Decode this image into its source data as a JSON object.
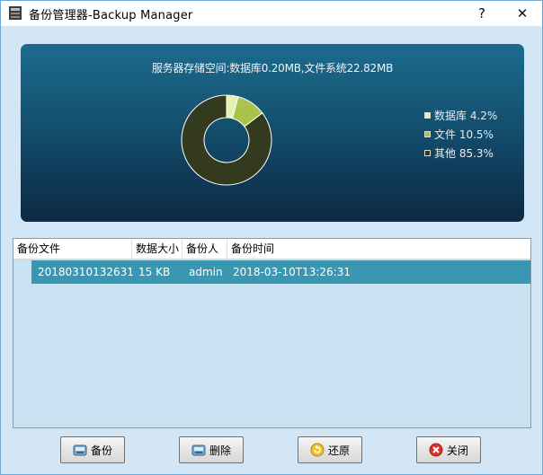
{
  "window": {
    "title": "备份管理器-Backup Manager",
    "help_label": "?",
    "close_label": "✕"
  },
  "chart_data": {
    "type": "pie",
    "title": "服务器存储空间:数据库0.20MB,文件系统22.82MB",
    "legend_position": "right",
    "series": [
      {
        "name": "数据库",
        "label": "数据库 4.2%",
        "value": 4.2,
        "color": "#e8f2b0"
      },
      {
        "name": "文件",
        "label": "文件 10.5%",
        "value": 10.5,
        "color": "#a9c34b"
      },
      {
        "name": "其他",
        "label": "其他 85.3%",
        "value": 85.3,
        "color": "#333a1d"
      }
    ]
  },
  "file_list": {
    "columns": [
      "备份文件",
      "数据大小",
      "备份人",
      "备份时间"
    ],
    "rows": [
      [
        "20180310132631",
        "15 KB",
        "admin",
        "2018-03-10T13:26:31"
      ]
    ]
  },
  "buttons": {
    "backup": "备份",
    "delete": "删除",
    "restore": "还原",
    "close": "关闭"
  },
  "icons": {
    "app": "backup-manager-icon",
    "backup": "disk-icon",
    "delete": "disk-icon",
    "restore": "restore-icon",
    "close": "close-circle-icon"
  }
}
